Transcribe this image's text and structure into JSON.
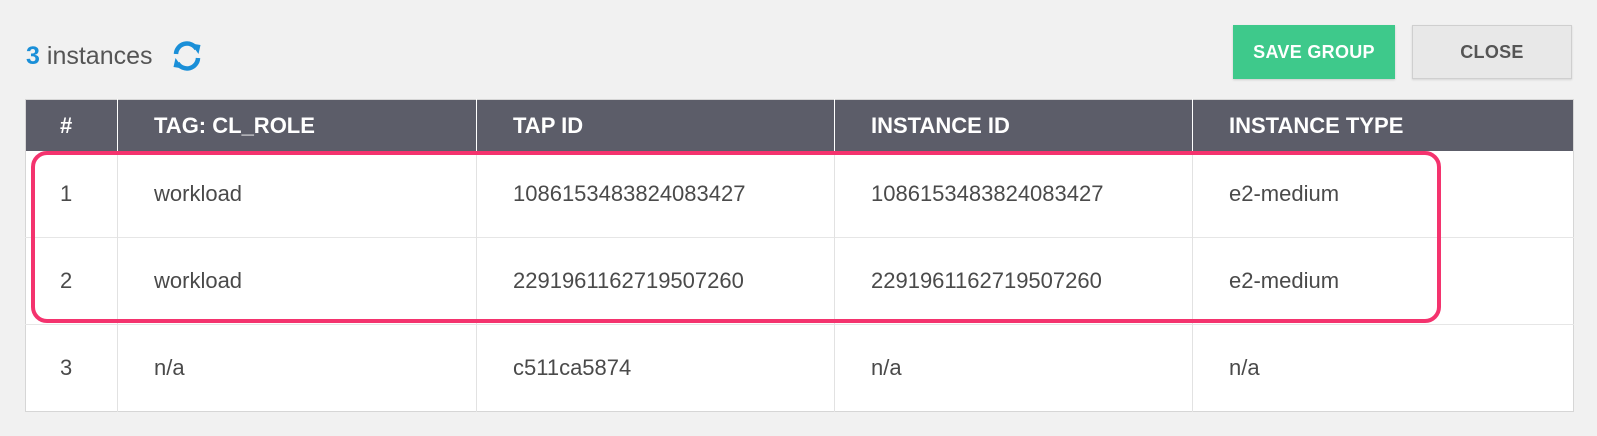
{
  "header": {
    "count": "3",
    "count_label": "instances",
    "save_label": "SAVE GROUP",
    "close_label": "CLOSE"
  },
  "colors": {
    "accent_blue": "#1a8fd8",
    "save_green": "#3ec98b",
    "header_bg": "#5c5d69",
    "highlight": "#f4336e"
  },
  "table": {
    "columns": [
      "#",
      "TAG: CL_ROLE",
      "TAP ID",
      "INSTANCE ID",
      "INSTANCE TYPE"
    ],
    "rows": [
      [
        "1",
        "workload",
        "1086153483824083427",
        "1086153483824083427",
        "e2-medium"
      ],
      [
        "2",
        "workload",
        "2291961162719507260",
        "2291961162719507260",
        "e2-medium"
      ],
      [
        "3",
        "n/a",
        "c511ca5874",
        "n/a",
        "n/a"
      ]
    ]
  },
  "icons": {
    "refresh": "refresh-icon"
  }
}
